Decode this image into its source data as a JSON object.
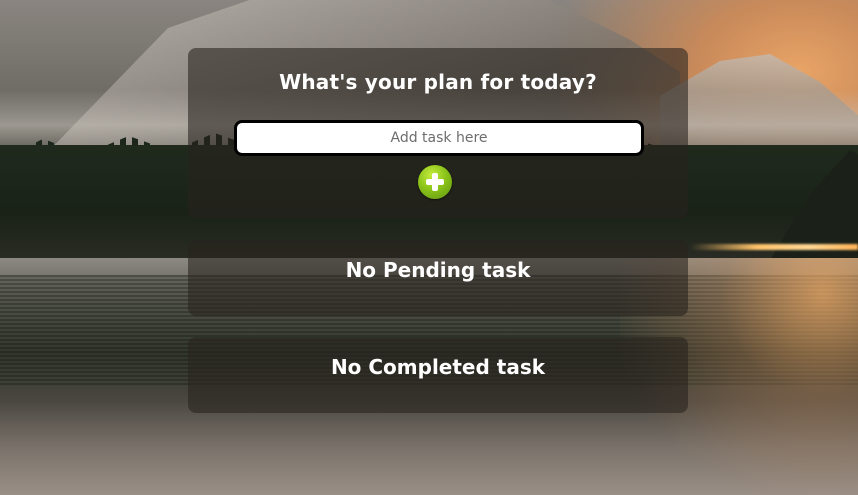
{
  "planner": {
    "heading": "What's your plan for today?",
    "task_input": {
      "placeholder": "Add task here",
      "value": ""
    },
    "add_button": {
      "icon": "plus-icon",
      "color": "#8bc41a"
    }
  },
  "pending": {
    "status": "No Pending task"
  },
  "completed": {
    "status": "No Completed task"
  }
}
